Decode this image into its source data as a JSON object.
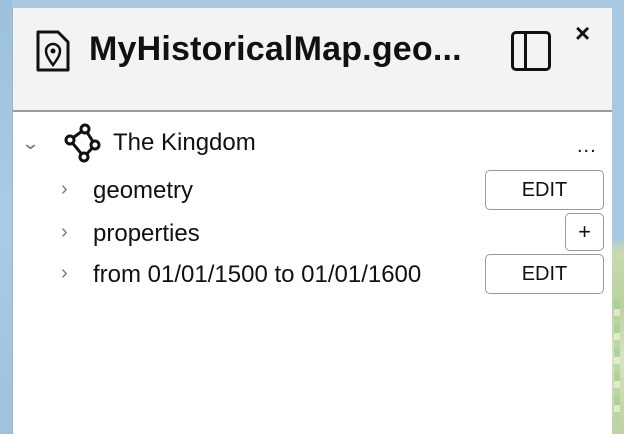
{
  "panel": {
    "title": "MyHistoricalMap.geo...",
    "close_label": "×"
  },
  "tree": {
    "root": {
      "label": "The Kingdom",
      "menu_label": "..."
    },
    "children": [
      {
        "label": "geometry",
        "action": "EDIT"
      },
      {
        "label": "properties",
        "action": "+"
      },
      {
        "label": "from 01/01/1500 to 01/01/1600",
        "action": "EDIT"
      }
    ]
  },
  "icons": {
    "file": "geojson-file-icon",
    "polygon": "polygon-icon",
    "sidebar": "sidebar-toggle-icon",
    "close": "close-icon"
  }
}
